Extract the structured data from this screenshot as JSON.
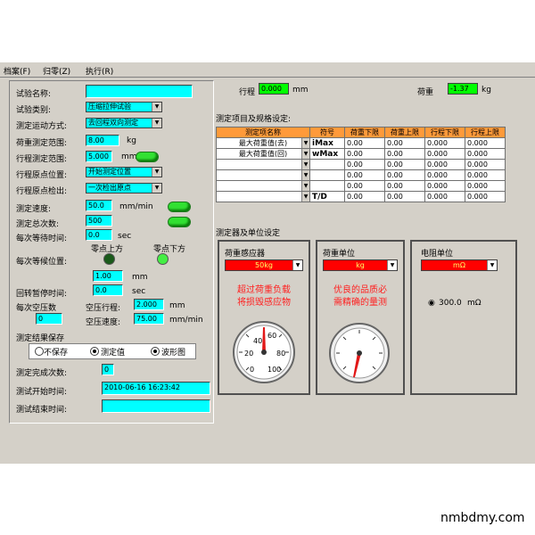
{
  "menu": {
    "file": "档案(F)",
    "zero": "归零(Z)",
    "exec": "执行(R)"
  },
  "left": {
    "test_name_label": "试验名称:",
    "test_type_label": "试验类别:",
    "test_type_value": "压缩拉伸试验",
    "motion_label": "测定运动方式:",
    "motion_value": "去回程双向测定",
    "load_range_label": "荷重测定范围:",
    "load_range_value": "8.00",
    "load_unit": "kg",
    "stroke_range_label": "行程测定范围:",
    "stroke_range_value": "5.000",
    "stroke_unit": "mm",
    "origin_pos_label": "行程原点位置:",
    "origin_pos_value": "开始测定位置",
    "origin_detect_label": "行程原点检出:",
    "origin_detect_value": "一次检出原点",
    "speed_label": "测定速度:",
    "speed_value": "50.0",
    "speed_unit": "mm/min",
    "total_count_label": "测定总次数:",
    "total_count_value": "500",
    "wait_time_label": "每次等待时间:",
    "wait_time_value": "0.0",
    "sec": "sec",
    "zero_above_label": "零点上方",
    "zero_below_label": "零点下方",
    "wait_pos_label": "每次等候位置:",
    "wait_pos_value": "1.00",
    "mm": "mm",
    "rotate_pause_label": "回转暂停时间:",
    "rotate_pause_value": "0.0",
    "idle_count_label": "每次空压数",
    "idle_count_value": "0",
    "idle_stroke_label": "空压行程:",
    "idle_stroke_value": "2.000",
    "idle_speed_label": "空压速度:",
    "idle_speed_value": "75.00",
    "idle_speed_unit": "mm/min",
    "save_label": "测定结果保存",
    "radio_nosave": "不保存",
    "radio_measured": "测定值",
    "radio_waveform": "波形图",
    "done_count_label": "测定完成次数:",
    "done_count_value": "0",
    "start_time_label": "测试开始时间:",
    "start_time_value": "2010-06-16 16:23:42",
    "end_time_label": "测试结束时间:",
    "end_time_value": ""
  },
  "top": {
    "stroke_label": "行程",
    "stroke_value": "0.000",
    "stroke_unit": "mm",
    "load_label": "荷重",
    "load_value": "-1.37",
    "load_unit": "kg"
  },
  "table": {
    "title": "测定项目及规格设定:",
    "headers": [
      "测定项名称",
      "符号",
      "荷重下限",
      "荷重上限",
      "行程下限",
      "行程上限"
    ],
    "rows": [
      {
        "name": "最大荷重值(去)",
        "symbol": "iMax",
        "v1": "0.00",
        "v2": "0.00",
        "v3": "0.000",
        "v4": "0.000"
      },
      {
        "name": "最大荷重值(回)",
        "symbol": "wMax",
        "v1": "0.00",
        "v2": "0.00",
        "v3": "0.000",
        "v4": "0.000"
      },
      {
        "name": "",
        "symbol": "",
        "v1": "0.00",
        "v2": "0.00",
        "v3": "0.000",
        "v4": "0.000"
      },
      {
        "name": "",
        "symbol": "",
        "v1": "0.00",
        "v2": "0.00",
        "v3": "0.000",
        "v4": "0.000"
      },
      {
        "name": "",
        "symbol": "",
        "v1": "0.00",
        "v2": "0.00",
        "v3": "0.000",
        "v4": "0.000"
      },
      {
        "name": "",
        "symbol": "T/D",
        "v1": "0.00",
        "v2": "0.00",
        "v3": "0.000",
        "v4": "0.000"
      }
    ]
  },
  "sensor": {
    "title": "测定器及单位设定",
    "load_sensor_label": "荷重感应器",
    "load_sensor_value": "50kg",
    "load_unit_label": "荷重单位",
    "load_unit_value": "kg",
    "res_unit_label": "电阻单位",
    "res_unit_value": "mΩ",
    "warn_text": "超过荷重负载\n将损毁感应物",
    "quality_text": "优良的品质必\n需精确的量测",
    "res_value": "300.0",
    "res_value_unit": "mΩ"
  },
  "gauge": {
    "labels": [
      "0",
      "20",
      "40",
      "60",
      "80",
      "100"
    ]
  },
  "watermark": "nmbdmy.com",
  "colors": {
    "cyan": "#00ffff",
    "green": "#00ff00",
    "red": "#ff0000",
    "orange": "#ff9a3a",
    "panel": "#d4d0c8"
  }
}
